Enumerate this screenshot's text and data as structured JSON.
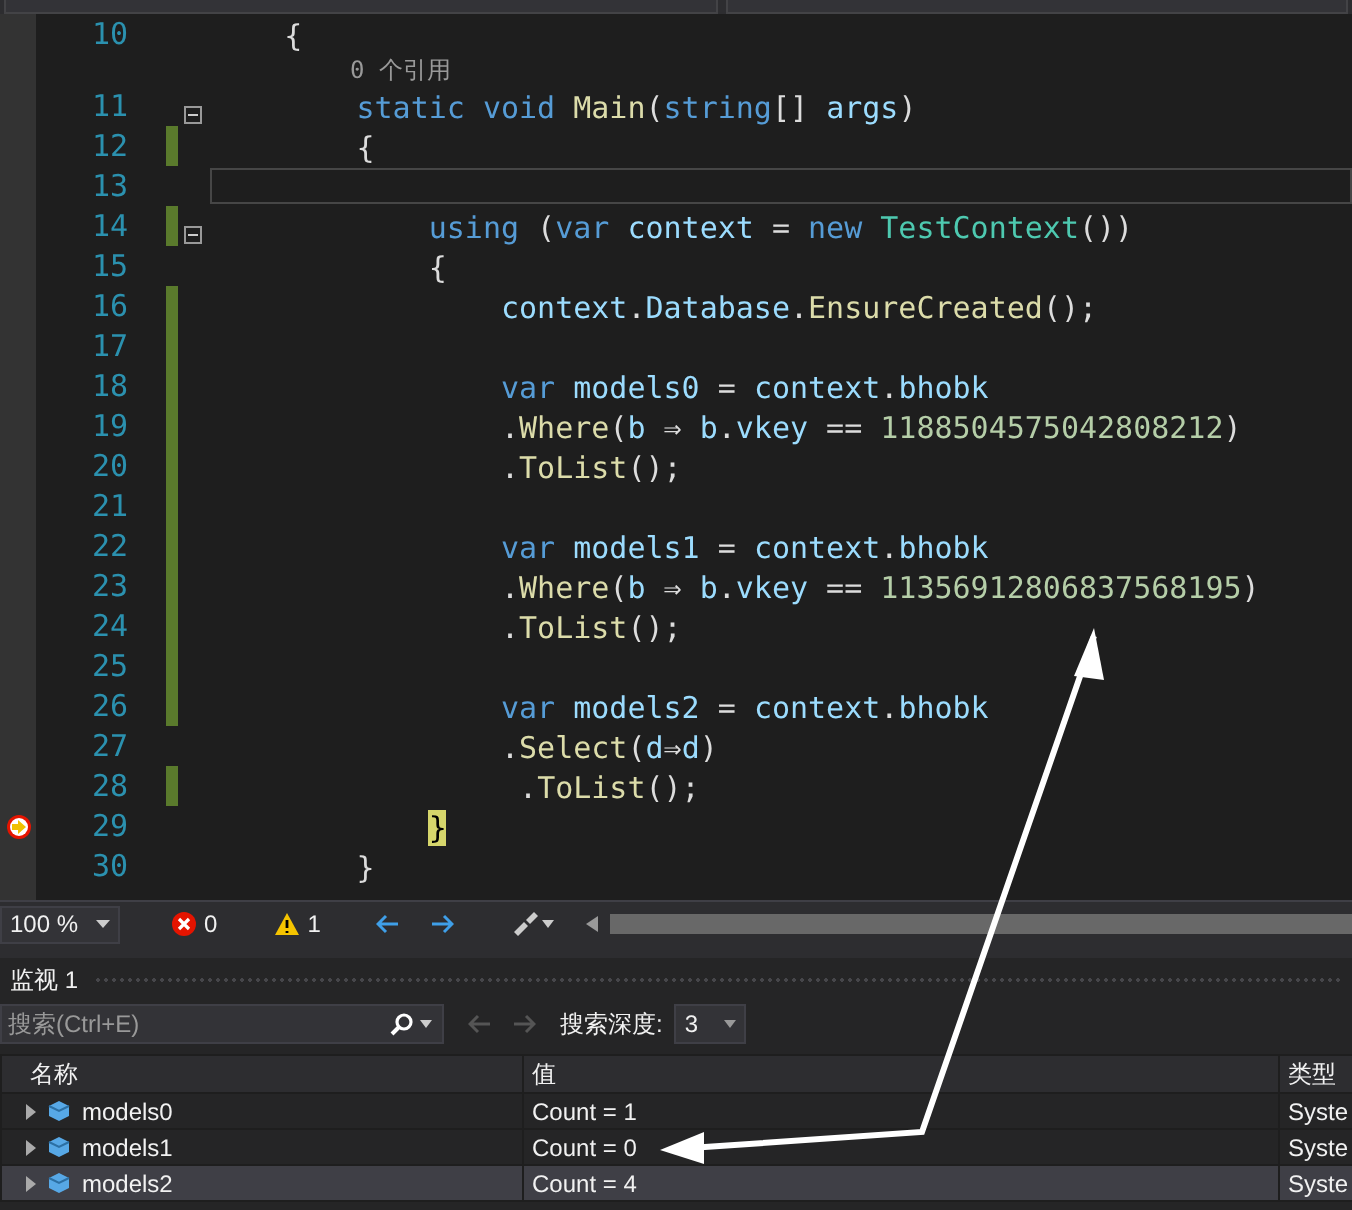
{
  "editor": {
    "lines": [
      {
        "kind": "code",
        "number": "10",
        "changed": false,
        "collapsible": false,
        "caret_line": false,
        "execution_pointer": false,
        "tokens": [
          {
            "kind": "plain",
            "text": "    {"
          }
        ]
      },
      {
        "kind": "codelens",
        "text": "0 个引用"
      },
      {
        "kind": "code",
        "number": "11",
        "changed": false,
        "collapsible": true,
        "caret_line": false,
        "execution_pointer": false,
        "tokens": [
          {
            "kind": "keyword",
            "text": "        static void "
          },
          {
            "kind": "method",
            "text": "Main"
          },
          {
            "kind": "plain",
            "text": "("
          },
          {
            "kind": "keyword",
            "text": "string"
          },
          {
            "kind": "plain",
            "text": "[] "
          },
          {
            "kind": "param",
            "text": "args"
          },
          {
            "kind": "plain",
            "text": ")"
          }
        ]
      },
      {
        "kind": "code",
        "number": "12",
        "changed": true,
        "collapsible": false,
        "caret_line": false,
        "execution_pointer": false,
        "tokens": [
          {
            "kind": "plain",
            "text": "        {"
          }
        ]
      },
      {
        "kind": "code",
        "number": "13",
        "changed": false,
        "collapsible": false,
        "caret_line": true,
        "execution_pointer": false
      },
      {
        "kind": "code",
        "number": "14",
        "changed": true,
        "collapsible": true,
        "caret_line": false,
        "execution_pointer": false,
        "tokens": [
          {
            "kind": "keyword",
            "text": "            using"
          },
          {
            "kind": "plain",
            "text": " ("
          },
          {
            "kind": "keyword",
            "text": "var"
          },
          {
            "kind": "param",
            "text": " context"
          },
          {
            "kind": "plain",
            "text": " = "
          },
          {
            "kind": "keyword",
            "text": "new "
          },
          {
            "kind": "type",
            "text": "TestContext"
          },
          {
            "kind": "plain",
            "text": "())"
          }
        ]
      },
      {
        "kind": "code",
        "number": "15",
        "changed": false,
        "collapsible": false,
        "caret_line": false,
        "execution_pointer": false,
        "tokens": [
          {
            "kind": "plain",
            "text": "            {"
          }
        ]
      },
      {
        "kind": "code",
        "number": "16",
        "changed": true,
        "collapsible": false,
        "caret_line": false,
        "execution_pointer": false,
        "tokens": [
          {
            "kind": "param",
            "text": "                context"
          },
          {
            "kind": "plain",
            "text": "."
          },
          {
            "kind": "param",
            "text": "Database"
          },
          {
            "kind": "plain",
            "text": "."
          },
          {
            "kind": "method",
            "text": "EnsureCreated"
          },
          {
            "kind": "plain",
            "text": "();"
          }
        ]
      },
      {
        "kind": "code",
        "number": "17",
        "changed": true,
        "collapsible": false,
        "caret_line": false,
        "execution_pointer": false
      },
      {
        "kind": "code",
        "number": "18",
        "changed": true,
        "collapsible": false,
        "caret_line": false,
        "execution_pointer": false,
        "tokens": [
          {
            "kind": "keyword",
            "text": "                var"
          },
          {
            "kind": "param",
            "text": " models0"
          },
          {
            "kind": "plain",
            "text": " = "
          },
          {
            "kind": "param",
            "text": "context"
          },
          {
            "kind": "plain",
            "text": "."
          },
          {
            "kind": "param",
            "text": "bhobk"
          }
        ]
      },
      {
        "kind": "code",
        "number": "19",
        "changed": true,
        "collapsible": false,
        "caret_line": false,
        "execution_pointer": false,
        "tokens": [
          {
            "kind": "plain",
            "text": "                ."
          },
          {
            "kind": "method",
            "text": "Where"
          },
          {
            "kind": "plain",
            "text": "("
          },
          {
            "kind": "param",
            "text": "b"
          },
          {
            "kind": "plain",
            "text": " ⇒ "
          },
          {
            "kind": "param",
            "text": "b"
          },
          {
            "kind": "plain",
            "text": "."
          },
          {
            "kind": "param",
            "text": "vkey"
          },
          {
            "kind": "plain",
            "text": " == "
          },
          {
            "kind": "number",
            "text": "1188504575042808212"
          },
          {
            "kind": "plain",
            "text": ")"
          }
        ]
      },
      {
        "kind": "code",
        "number": "20",
        "changed": true,
        "collapsible": false,
        "caret_line": false,
        "execution_pointer": false,
        "tokens": [
          {
            "kind": "plain",
            "text": "                ."
          },
          {
            "kind": "method",
            "text": "ToList"
          },
          {
            "kind": "plain",
            "text": "();"
          }
        ]
      },
      {
        "kind": "code",
        "number": "21",
        "changed": true,
        "collapsible": false,
        "caret_line": false,
        "execution_pointer": false
      },
      {
        "kind": "code",
        "number": "22",
        "changed": true,
        "collapsible": false,
        "caret_line": false,
        "execution_pointer": false,
        "tokens": [
          {
            "kind": "keyword",
            "text": "                var"
          },
          {
            "kind": "param",
            "text": " models1"
          },
          {
            "kind": "plain",
            "text": " = "
          },
          {
            "kind": "param",
            "text": "context"
          },
          {
            "kind": "plain",
            "text": "."
          },
          {
            "kind": "param",
            "text": "bhobk"
          }
        ]
      },
      {
        "kind": "code",
        "number": "23",
        "changed": true,
        "collapsible": false,
        "caret_line": false,
        "execution_pointer": false,
        "tokens": [
          {
            "kind": "plain",
            "text": "                ."
          },
          {
            "kind": "method",
            "text": "Where"
          },
          {
            "kind": "plain",
            "text": "("
          },
          {
            "kind": "param",
            "text": "b"
          },
          {
            "kind": "plain",
            "text": " ⇒ "
          },
          {
            "kind": "param",
            "text": "b"
          },
          {
            "kind": "plain",
            "text": "."
          },
          {
            "kind": "param",
            "text": "vkey"
          },
          {
            "kind": "plain",
            "text": " == "
          },
          {
            "kind": "number",
            "text": "11356912806837568195"
          },
          {
            "kind": "plain",
            "text": ")"
          }
        ]
      },
      {
        "kind": "code",
        "number": "24",
        "changed": true,
        "collapsible": false,
        "caret_line": false,
        "execution_pointer": false,
        "tokens": [
          {
            "kind": "plain",
            "text": "                ."
          },
          {
            "kind": "method",
            "text": "ToList"
          },
          {
            "kind": "plain",
            "text": "();"
          }
        ]
      },
      {
        "kind": "code",
        "number": "25",
        "changed": true,
        "collapsible": false,
        "caret_line": false,
        "execution_pointer": false
      },
      {
        "kind": "code",
        "number": "26",
        "changed": true,
        "collapsible": false,
        "caret_line": false,
        "execution_pointer": false,
        "tokens": [
          {
            "kind": "keyword",
            "text": "                var"
          },
          {
            "kind": "param",
            "text": " models2"
          },
          {
            "kind": "plain",
            "text": " = "
          },
          {
            "kind": "param",
            "text": "context"
          },
          {
            "kind": "plain",
            "text": "."
          },
          {
            "kind": "param",
            "text": "bhobk"
          }
        ]
      },
      {
        "kind": "code",
        "number": "27",
        "changed": false,
        "collapsible": false,
        "caret_line": false,
        "execution_pointer": false,
        "tokens": [
          {
            "kind": "plain",
            "text": "                ."
          },
          {
            "kind": "method",
            "text": "Select"
          },
          {
            "kind": "plain",
            "text": "("
          },
          {
            "kind": "param",
            "text": "d"
          },
          {
            "kind": "plain",
            "text": "⇒"
          },
          {
            "kind": "param",
            "text": "d"
          },
          {
            "kind": "plain",
            "text": ")"
          }
        ]
      },
      {
        "kind": "code",
        "number": "28",
        "changed": true,
        "collapsible": false,
        "caret_line": false,
        "execution_pointer": false,
        "tokens": [
          {
            "kind": "plain",
            "text": "                 ."
          },
          {
            "kind": "method",
            "text": "ToList"
          },
          {
            "kind": "plain",
            "text": "();"
          }
        ]
      },
      {
        "kind": "code",
        "number": "29",
        "changed": false,
        "collapsible": false,
        "caret_line": false,
        "execution_pointer": true,
        "tokens": [
          {
            "kind": "current",
            "text": "            }"
          }
        ]
      },
      {
        "kind": "code",
        "number": "30",
        "changed": false,
        "collapsible": false,
        "caret_line": false,
        "execution_pointer": false,
        "tokens": [
          {
            "kind": "plain",
            "text": "        }"
          }
        ]
      }
    ]
  },
  "status_strip": {
    "zoom": "100 %",
    "errors": "0",
    "warnings": "1"
  },
  "watch": {
    "title": "监视 1",
    "search": {
      "placeholder": "搜索(Ctrl+E)"
    },
    "depth_label": "搜索深度:",
    "depth": "3",
    "columns": [
      "名称",
      "值",
      "类型"
    ],
    "rows": [
      {
        "name": "models0",
        "value": "Count = 1",
        "type": "Syste",
        "selected": false
      },
      {
        "name": "models1",
        "value": "Count = 0",
        "type": "Syste",
        "selected": false
      },
      {
        "name": "models2",
        "value": "Count = 4",
        "type": "Syste",
        "selected": true
      }
    ]
  }
}
